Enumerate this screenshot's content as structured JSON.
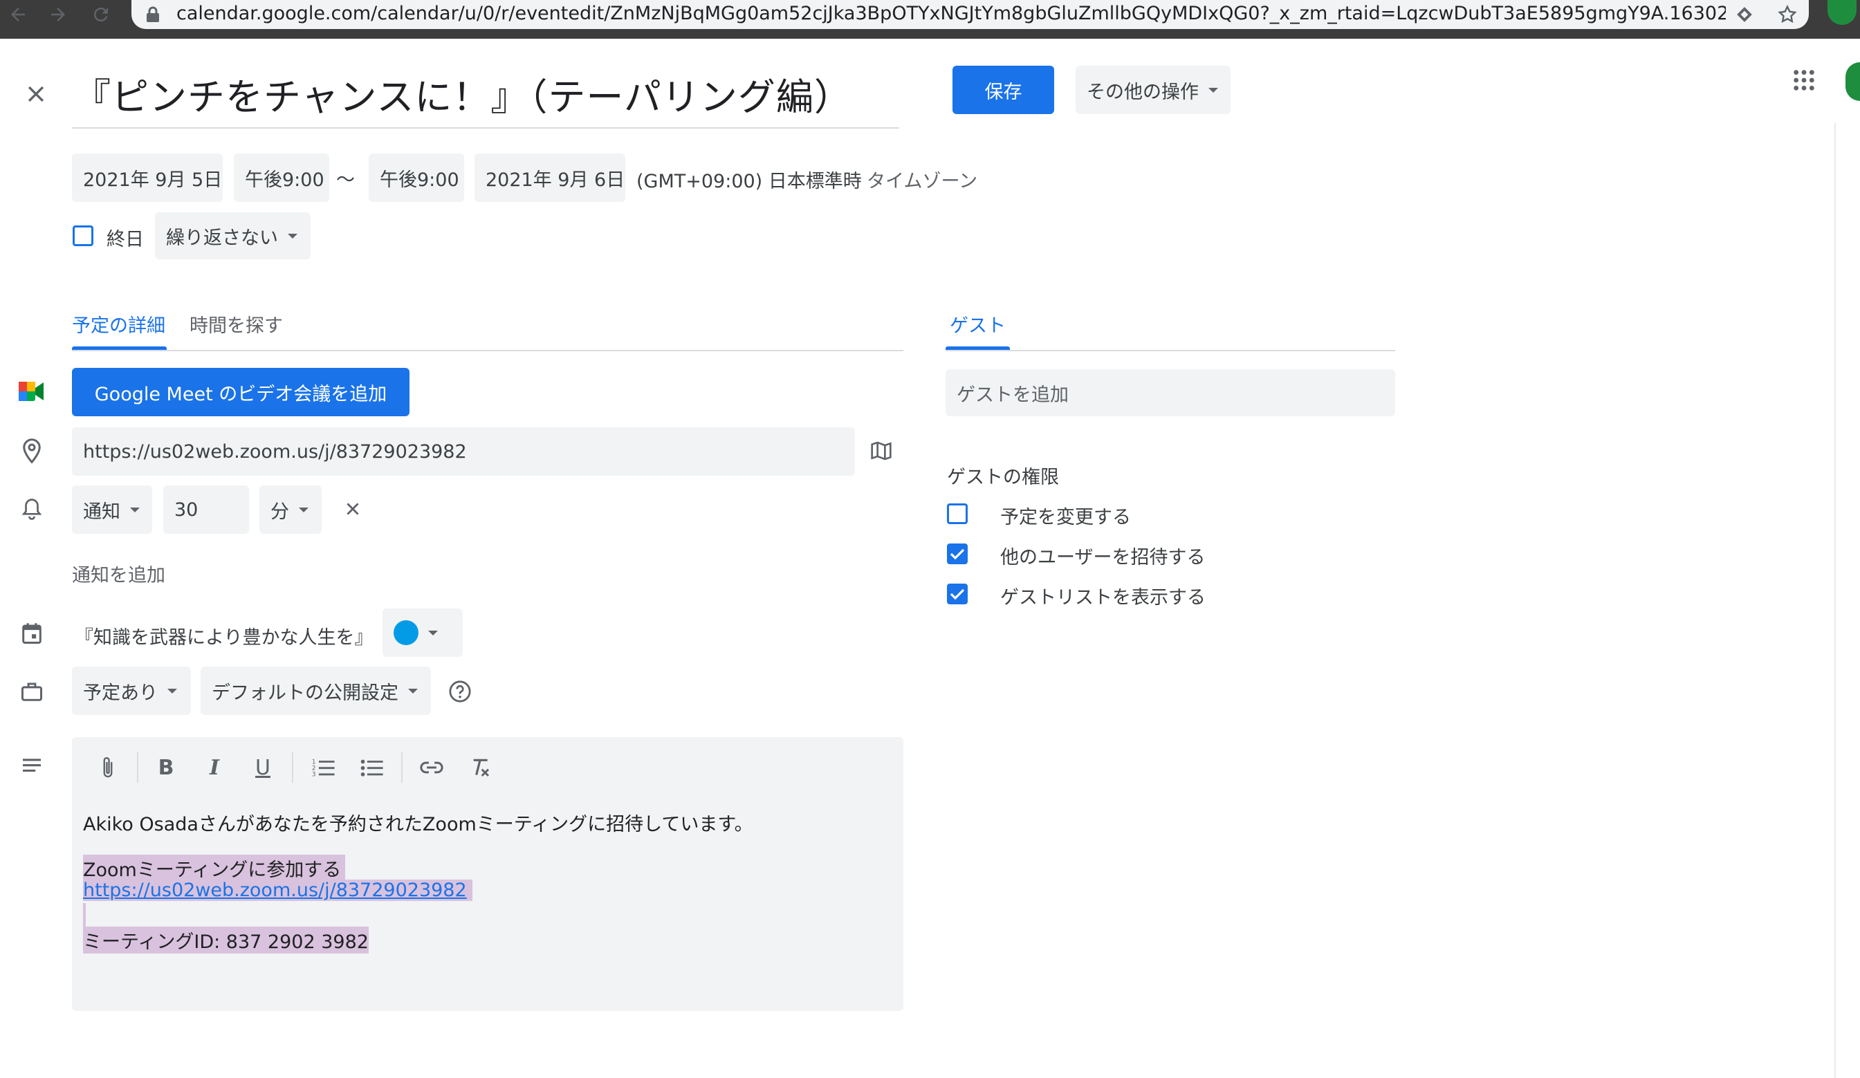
{
  "browser": {
    "url": "calendar.google.com/calendar/u/0/r/eventedit/ZnMzNjBqMGg0am52cjJka3BpOTYxNGJtYm8gbGluZmllbGQyMDIxQG0?_x_zm_rtaid=LqzcwDubT3aE5895gmgY9A.1630236292..."
  },
  "event": {
    "title": "『ピンチをチャンスに！』（テーパリング編）",
    "save_label": "保存",
    "more_actions_label": "その他の操作",
    "start_date": "2021年 9月 5日",
    "start_time": "午後9:00",
    "range_sep": "〜",
    "end_time": "午後9:00",
    "end_date": "2021年 9月 6日",
    "timezone_value": "(GMT+09:00) 日本標準時",
    "timezone_label": "タイムゾーン",
    "all_day_label": "終日",
    "repeat_label": "繰り返さない"
  },
  "tabs": {
    "details": "予定の詳細",
    "find_time": "時間を探す",
    "guests": "ゲスト"
  },
  "details": {
    "meet_button": "Google Meet のビデオ会議を追加",
    "location": "https://us02web.zoom.us/j/83729023982",
    "notification_type": "通知",
    "notification_value": "30",
    "notification_unit": "分",
    "add_notification": "通知を追加",
    "calendar_name": "『知識を武器により豊かな人生を』",
    "calendar_color": "#039be5",
    "availability": "予定あり",
    "visibility": "デフォルトの公開設定"
  },
  "description": {
    "line1": "Akiko Osadaさんがあなたを予約されたZoomミーティングに招待しています。",
    "line2": "Zoomミーティングに参加する",
    "link": "https://us02web.zoom.us/j/83729023982",
    "line4": "ミーティングID: 837 2902 3982"
  },
  "guests": {
    "add_placeholder": "ゲストを追加",
    "permissions_title": "ゲストの権限",
    "perm_modify": "予定を変更する",
    "perm_invite": "他のユーザーを招待する",
    "perm_see_list": "ゲストリストを表示する"
  },
  "colors": {
    "accent": "#1a73e8",
    "chip_bg": "#f1f3f4",
    "highlight": "#d9c2dd"
  }
}
